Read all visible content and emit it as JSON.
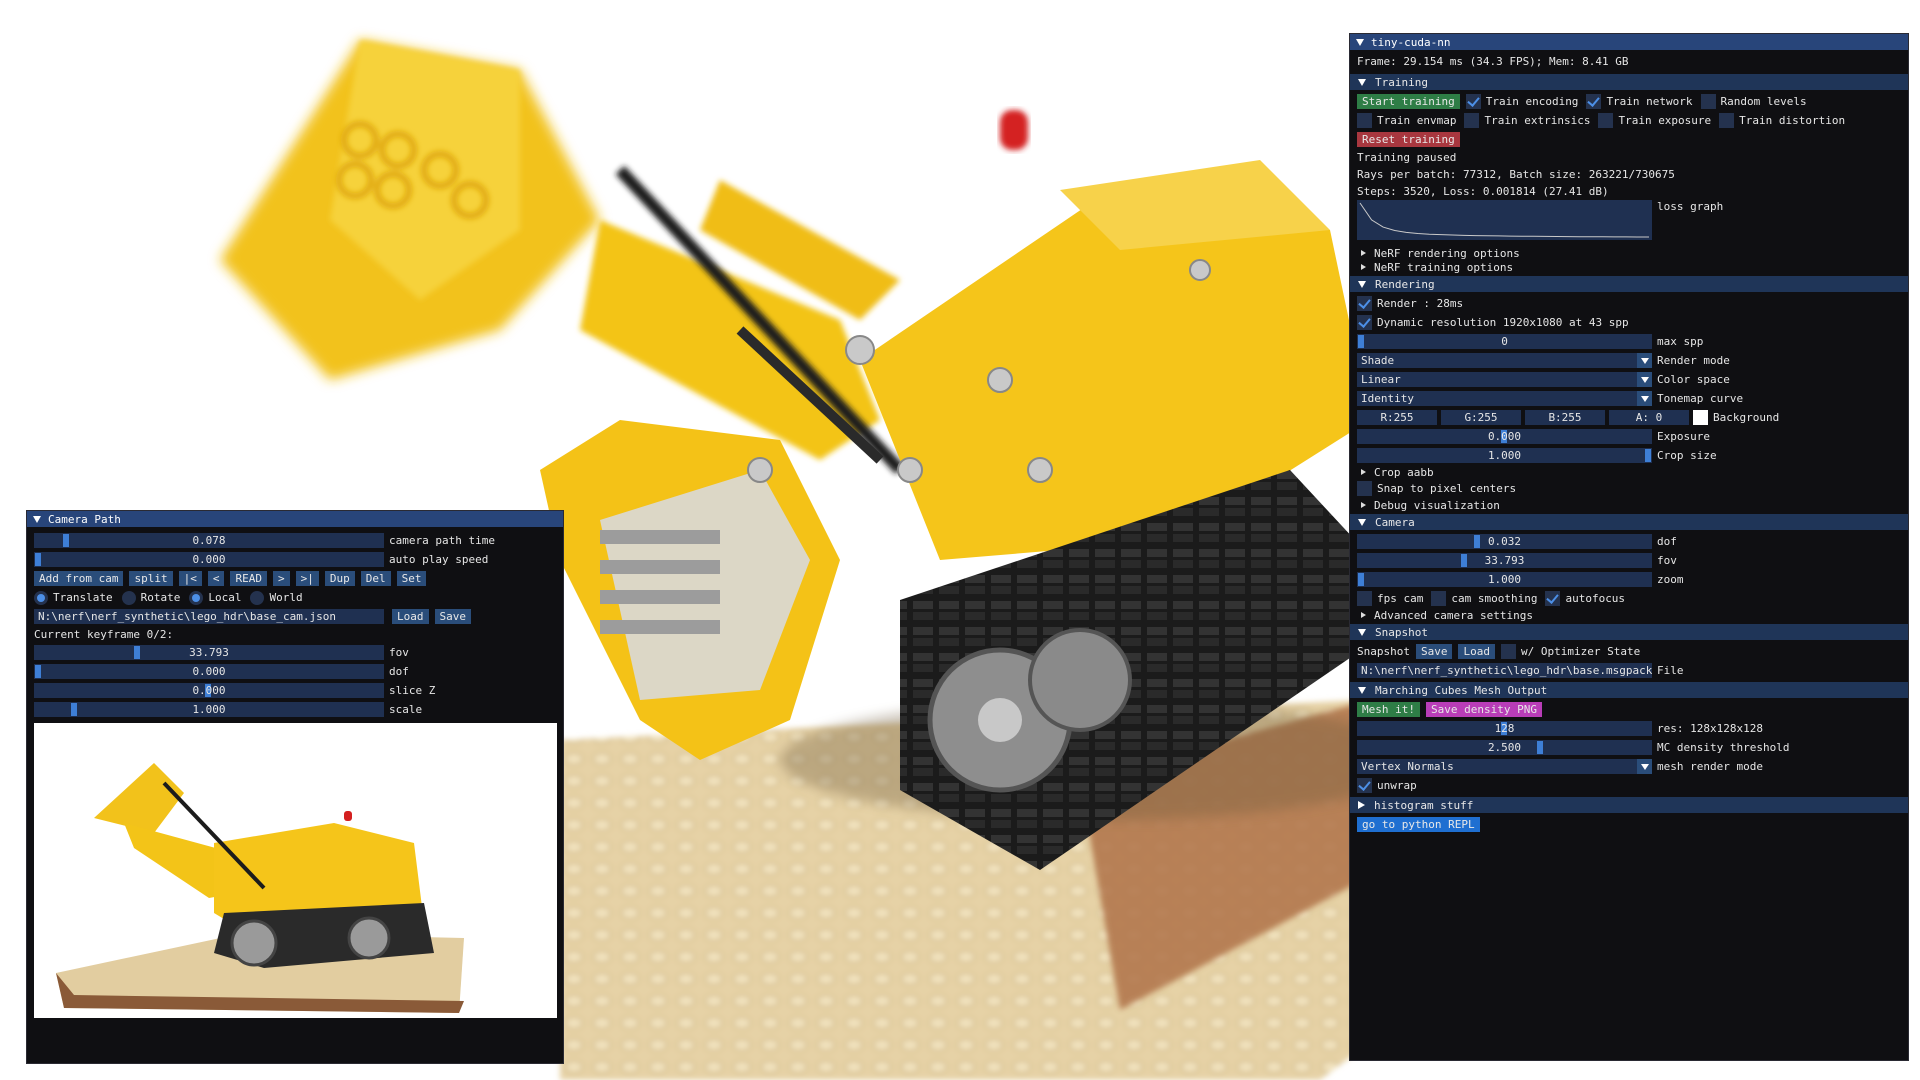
{
  "main": {
    "title": "tiny-cuda-nn",
    "frame_info": "Frame: 29.154 ms (34.3 FPS); Mem: 8.41 GB",
    "training": {
      "header": "Training",
      "start_button": "Start training",
      "train_encoding": "Train encoding",
      "train_network": "Train network",
      "random_levels": "Random levels",
      "train_envmap": "Train envmap",
      "train_extrinsics": "Train extrinsics",
      "train_exposure": "Train exposure",
      "train_distortion": "Train distortion",
      "reset_button": "Reset training",
      "status": "Training paused",
      "rays_info": "Rays per batch: 77312, Batch size: 263221/730675",
      "steps_info": "Steps: 3520, Loss: 0.001814 (27.41 dB)",
      "loss_graph_label": "loss graph",
      "loss_curve": [
        1.0,
        0.55,
        0.36,
        0.27,
        0.22,
        0.19,
        0.17,
        0.16,
        0.15,
        0.14,
        0.135,
        0.13,
        0.125,
        0.12,
        0.118,
        0.115,
        0.112,
        0.11,
        0.108,
        0.106,
        0.104,
        0.102,
        0.1,
        0.099,
        0.098,
        0.097
      ],
      "nerf_rendering_options": "NeRF rendering options",
      "nerf_training_options": "NeRF training options"
    },
    "rendering": {
      "header": "Rendering",
      "render_label": "Render : 28ms",
      "dynamic_res_label": "Dynamic resolution 1920x1080 at 43 spp",
      "max_spp_value": "0",
      "max_spp_label": "max spp",
      "render_mode_value": "Shade",
      "render_mode_label": "Render mode",
      "color_space_value": "Linear",
      "color_space_label": "Color space",
      "tonemap_value": "Identity",
      "tonemap_label": "Tonemap curve",
      "bg_r": "R:255",
      "bg_g": "G:255",
      "bg_b": "B:255",
      "bg_a": "A:  0",
      "background_label": "Background",
      "exposure_value": "0.000",
      "exposure_label": "Exposure",
      "crop_size_value": "1.000",
      "crop_size_label": "Crop size",
      "crop_aabb": "Crop aabb",
      "snap_pixel": "Snap to pixel centers",
      "debug_vis": "Debug visualization"
    },
    "camera": {
      "header": "Camera",
      "dof_value": "0.032",
      "dof_label": "dof",
      "fov_value": "33.793",
      "fov_label": "fov",
      "zoom_value": "1.000",
      "zoom_label": "zoom",
      "fps_cam": "fps cam",
      "cam_smoothing": "cam smoothing",
      "autofocus": "autofocus",
      "advanced": "Advanced camera settings"
    },
    "snapshot": {
      "header": "Snapshot",
      "snapshot_label": "Snapshot",
      "save_button": "Save",
      "load_button": "Load",
      "optimizer_state": "w/ Optimizer State",
      "file_value": "N:\\nerf\\nerf_synthetic\\lego_hdr\\base.msgpack",
      "file_label": "File"
    },
    "mesh": {
      "header": "Marching Cubes Mesh Output",
      "mesh_button": "Mesh it!",
      "save_density_button": "Save density PNG",
      "res_value": "128",
      "res_label": "res: 128x128x128",
      "threshold_value": "2.500",
      "threshold_label": "MC density threshold",
      "render_mode_value": "Vertex Normals",
      "render_mode_label": "mesh render mode",
      "unwrap": "unwrap"
    },
    "histogram_header": "histogram stuff",
    "repl_button": "go to python REPL"
  },
  "camera_path": {
    "title": "Camera Path",
    "path_time_value": "0.078",
    "path_time_label": "camera path time",
    "auto_play_value": "0.000",
    "auto_play_label": "auto play speed",
    "buttons": [
      "Add from cam",
      "split",
      "|<",
      "<",
      "READ",
      ">",
      ">|",
      "Dup",
      "Del",
      "Set"
    ],
    "translate": "Translate",
    "rotate": "Rotate",
    "local": "Local",
    "world": "World",
    "path_file": "N:\\nerf\\nerf_synthetic\\lego_hdr\\base_cam.json",
    "load_button": "Load",
    "save_button": "Save",
    "keyframe_info": "Current keyframe 0/2:",
    "fov_value": "33.793",
    "fov_label": "fov",
    "dof_value": "0.000",
    "dof_label": "dof",
    "slice_value": "0.000",
    "slice_label": "slice Z",
    "scale_value": "1.000",
    "scale_label": "scale"
  },
  "colors": {
    "title_bar": "#28457a",
    "header": "#1f3558",
    "frame_bg": "#1f3051",
    "grab": "#3e7fd6",
    "green_button": "#2e7d46",
    "red_button": "#a8373f",
    "magenta_button": "#b93db8",
    "blue_button": "#1f6fd1"
  }
}
